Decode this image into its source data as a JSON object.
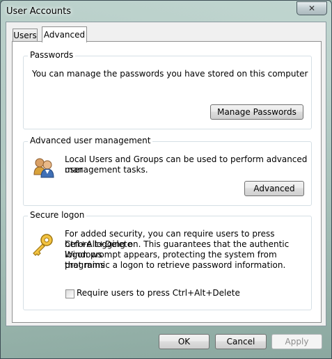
{
  "window": {
    "title": "User Accounts",
    "close_glyph": "✕"
  },
  "tabs": [
    {
      "label": "Users",
      "selected": false
    },
    {
      "label": "Advanced",
      "selected": true
    }
  ],
  "passwords": {
    "legend": "Passwords",
    "description": "You can manage the passwords you have stored on this computer",
    "button_label": "Manage Passwords"
  },
  "advanced_user_management": {
    "legend": "Advanced user management",
    "description_line1": "Local Users and Groups can be used to perform advanced user",
    "description_line2": "management tasks.",
    "button_label": "Advanced",
    "icon": "users-icon"
  },
  "secure_logon": {
    "legend": "Secure logon",
    "description_line1": "For added security, you can require users to press Ctrl+Alt+Delete",
    "description_line2": "before logging on. This guarantees that the authentic Windows",
    "description_line3": "logon prompt appears, protecting the system from programs",
    "description_line4": "that mimic a logon to retrieve password information.",
    "checkbox_label": "Require users to press Ctrl+Alt+Delete",
    "checkbox_checked": false,
    "icon": "key-icon"
  },
  "footer": {
    "ok_label": "OK",
    "cancel_label": "Cancel",
    "apply_label": "Apply",
    "apply_enabled": false
  }
}
